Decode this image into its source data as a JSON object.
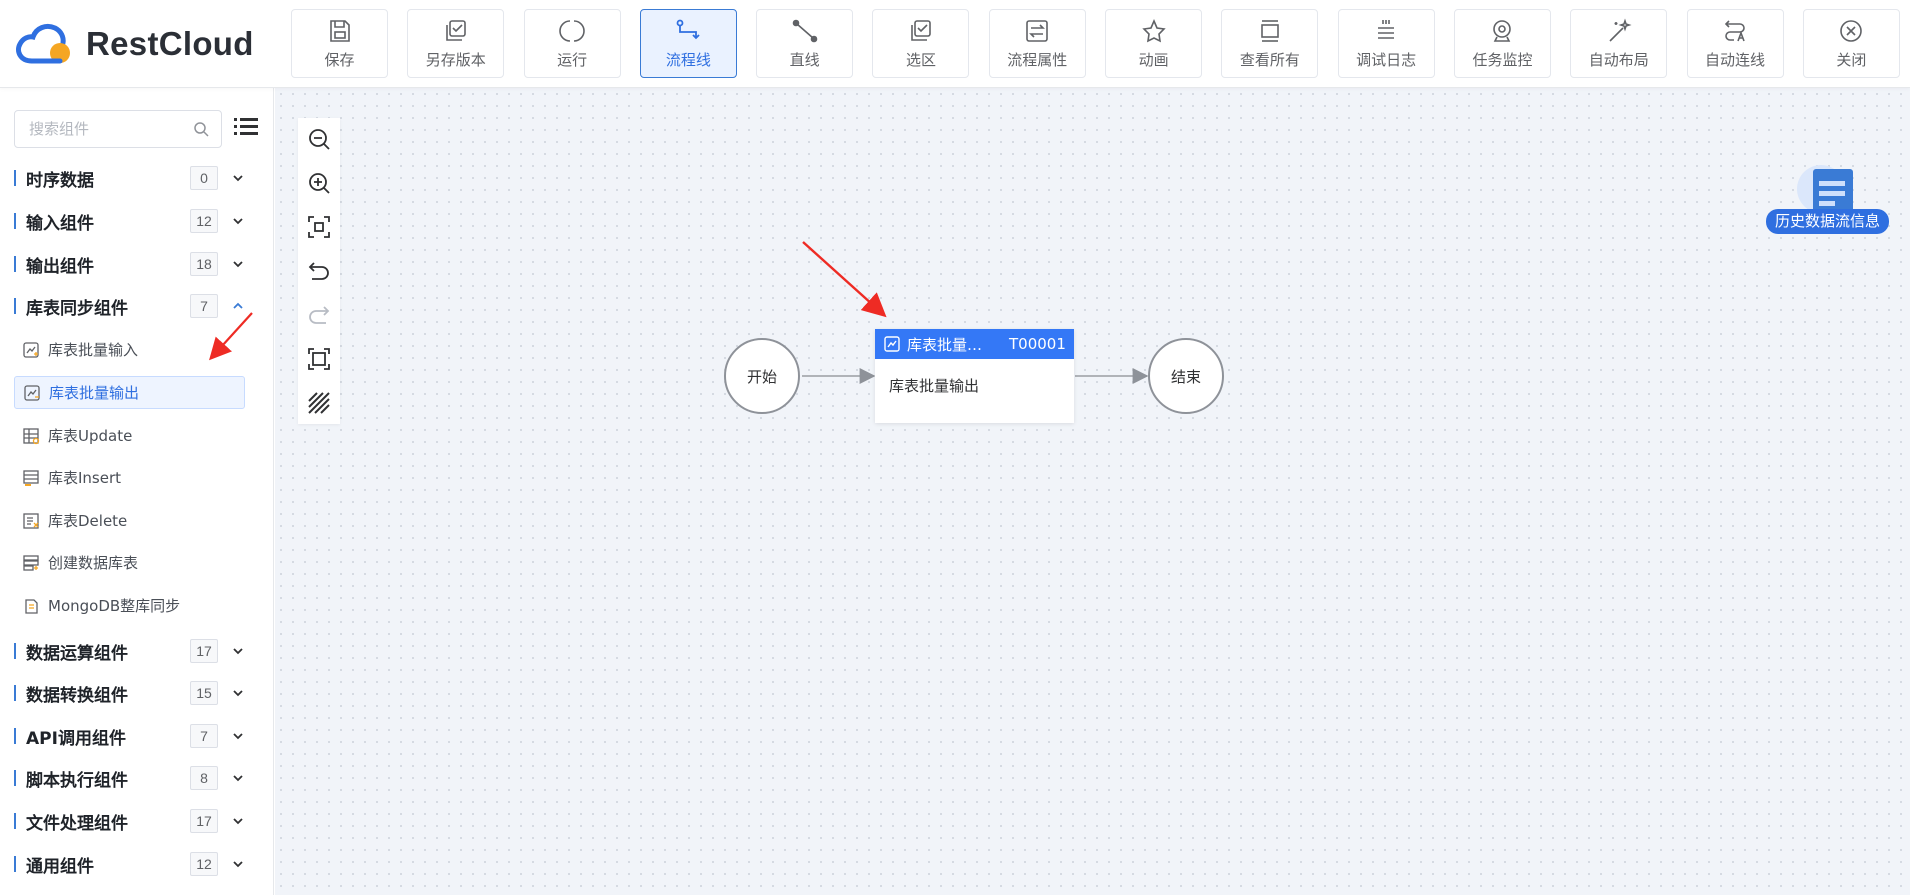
{
  "app": {
    "logo_text": "RestCloud"
  },
  "toolbar": [
    {
      "label": "保存",
      "icon": "save-icon"
    },
    {
      "label": "另存版本",
      "icon": "save-version-icon"
    },
    {
      "label": "运行",
      "icon": "run-icon"
    },
    {
      "label": "流程线",
      "icon": "flow-line-icon",
      "active": true
    },
    {
      "label": "直线",
      "icon": "straight-line-icon"
    },
    {
      "label": "选区",
      "icon": "select-area-icon"
    },
    {
      "label": "流程属性",
      "icon": "flow-properties-icon"
    },
    {
      "label": "动画",
      "icon": "animation-icon"
    },
    {
      "label": "查看所有",
      "icon": "view-all-icon"
    },
    {
      "label": "调试日志",
      "icon": "debug-log-icon"
    },
    {
      "label": "任务监控",
      "icon": "task-monitor-icon"
    },
    {
      "label": "自动布局",
      "icon": "auto-layout-icon"
    },
    {
      "label": "自动连线",
      "icon": "auto-connect-icon"
    },
    {
      "label": "关闭",
      "icon": "close-icon"
    }
  ],
  "sidebar": {
    "search_placeholder": "搜索组件",
    "categories": [
      {
        "title": "时序数据",
        "count": "0",
        "expanded": false
      },
      {
        "title": "输入组件",
        "count": "12",
        "expanded": false
      },
      {
        "title": "输出组件",
        "count": "18",
        "expanded": false
      },
      {
        "title": "库表同步组件",
        "count": "7",
        "expanded": true
      },
      {
        "title": "数据运算组件",
        "count": "17",
        "expanded": false
      },
      {
        "title": "数据转换组件",
        "count": "15",
        "expanded": false
      },
      {
        "title": "API调用组件",
        "count": "7",
        "expanded": false
      },
      {
        "title": "脚本执行组件",
        "count": "8",
        "expanded": false
      },
      {
        "title": "文件处理组件",
        "count": "17",
        "expanded": false
      },
      {
        "title": "通用组件",
        "count": "12",
        "expanded": false
      }
    ],
    "sync_items": [
      {
        "label": "库表批量输入"
      },
      {
        "label": "库表批量输出",
        "selected": true
      },
      {
        "label": "库表Update"
      },
      {
        "label": "库表Insert"
      },
      {
        "label": "库表Delete"
      },
      {
        "label": "创建数据库表"
      },
      {
        "label": "MongoDB整库同步"
      }
    ]
  },
  "canvas": {
    "start_label": "开始",
    "end_label": "结束",
    "task": {
      "title": "库表批量…",
      "id": "T00001",
      "body": "库表批量输出"
    },
    "history_label": "历史数据流信息"
  },
  "colors": {
    "accent": "#3478f6",
    "annotation_arrow": "#ee2b24"
  }
}
